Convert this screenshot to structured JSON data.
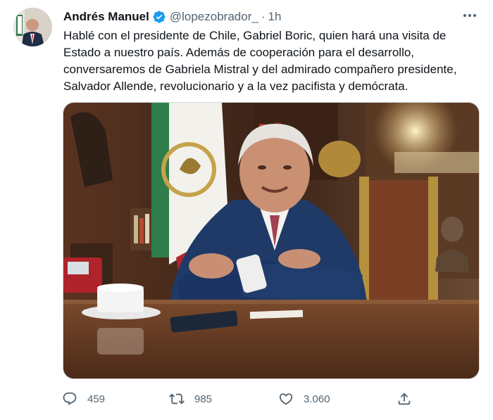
{
  "author": {
    "name": "Andrés Manuel",
    "handle": "@lopezobrador_",
    "separator": "·",
    "time": "1h",
    "verified": true
  },
  "tweet": {
    "text": "Hablé con el presidente de Chile, Gabriel Boric, quien hará una visita de Estado a nuestro país. Además de cooperación para el desarrollo, conversaremos de Gabriela Mistral y del admirado compañero presidente, Salvador Allende, revolucionario y a la vez pacifista y demócrata."
  },
  "actions": {
    "replies": "459",
    "retweets": "985",
    "likes": "3.060"
  },
  "icons": {
    "verified": "verified-badge-icon",
    "more": "more-options-icon",
    "reply": "reply-icon",
    "retweet": "retweet-icon",
    "like": "heart-icon",
    "share": "share-icon"
  },
  "colors": {
    "verified": "#1d9bf0",
    "secondary_text": "#536471"
  }
}
